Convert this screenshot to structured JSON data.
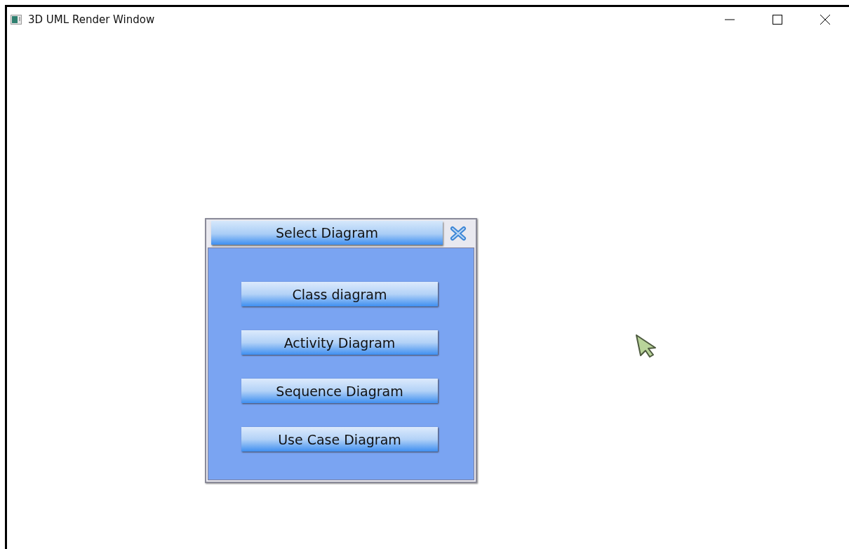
{
  "window": {
    "title": "3D UML Render Window"
  },
  "dialog": {
    "title": "Select Diagram",
    "buttons": [
      {
        "label": "Class diagram"
      },
      {
        "label": "Activity Diagram"
      },
      {
        "label": "Sequence Diagram"
      },
      {
        "label": "Use Case Diagram"
      }
    ]
  }
}
